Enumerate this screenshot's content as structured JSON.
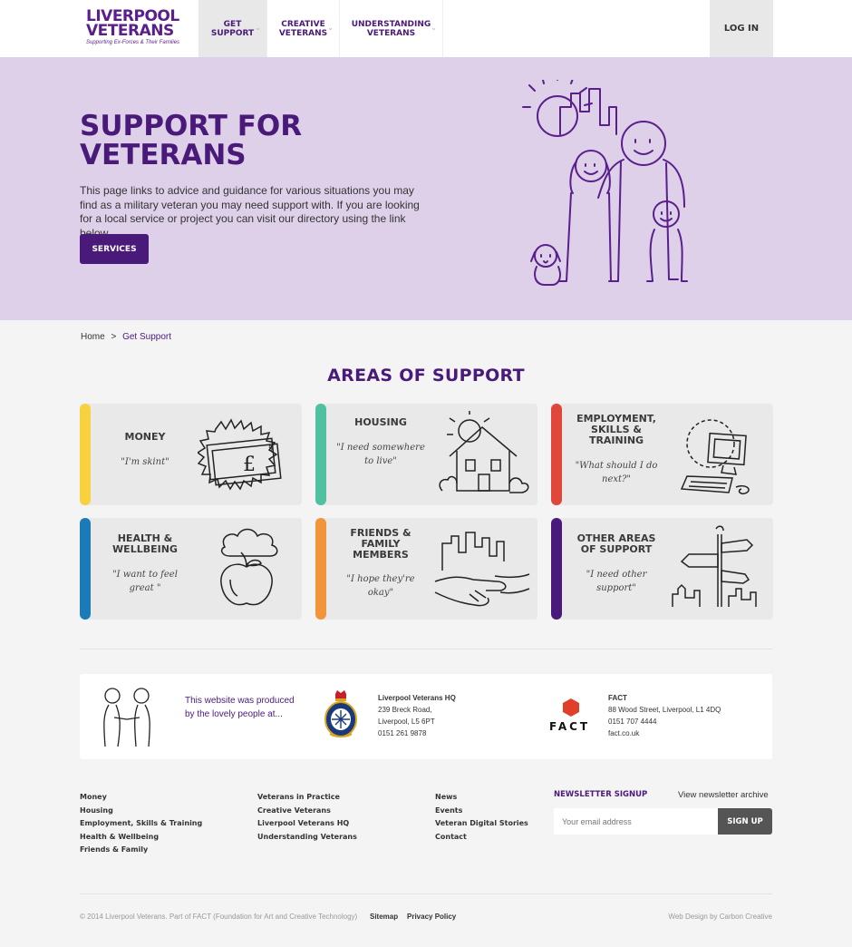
{
  "header": {
    "logo_line1": "LIVERPOOL",
    "logo_line2": "VETERANS",
    "logo_tagline": "Supporting Ex-Forces & Their Families",
    "nav": [
      {
        "label": "GET SUPPORT"
      },
      {
        "label": "CREATIVE VETERANS"
      },
      {
        "label": "UNDERSTANDING VETERANS"
      }
    ],
    "login_label": "LOG IN"
  },
  "hero": {
    "title": "SUPPORT FOR VETERANS",
    "text": "This page links to advice and guidance for various situations you may find as a military veteran you may need support with. If you are looking for a local service or project you can visit our directory using the link below.",
    "button": "SERVICES"
  },
  "breadcrumb": {
    "home": "Home",
    "separator": ">",
    "current": "Get Support"
  },
  "areas": {
    "title": "AREAS OF SUPPORT",
    "cards": [
      {
        "title": "MONEY",
        "quote": "\"I'm skint\"",
        "color": "#f7d23e",
        "icon": "banknote-icon"
      },
      {
        "title": "HOUSING",
        "quote": "\"I need somewhere to live\"",
        "color": "#4fc1a1",
        "icon": "house-icon"
      },
      {
        "title": "EMPLOYMENT, SKILLS & TRAINING",
        "quote": "\"What should I do next?\"",
        "color": "#e0463a",
        "icon": "computer-icon"
      },
      {
        "title": "HEALTH & WELLBEING",
        "quote": "\"I want to feel great \"",
        "color": "#1a7bb8",
        "icon": "apple-icon"
      },
      {
        "title": "FRIENDS & FAMILY MEMBERS",
        "quote": "\"I hope they're okay\"",
        "color": "#f2943a",
        "icon": "handshake-icon"
      },
      {
        "title": "OTHER AREAS OF SUPPORT",
        "quote": "\"I need other support\"",
        "color": "#4a1a7a",
        "icon": "signpost-icon"
      }
    ]
  },
  "partners": {
    "produced_text": "This website was produced by the lovely people at...",
    "hq": {
      "name": "Liverpool Veterans HQ",
      "line1": "239 Breck Road,",
      "line2": "Liverpool, L5 6PT",
      "phone": "0151 261 9878"
    },
    "fact": {
      "logo_text": "FACT",
      "name": "FACT",
      "line1": "88 Wood Street, Liverpool, L1 4DQ",
      "phone": "0151 707 4444",
      "web": "fact.co.uk"
    }
  },
  "footer": {
    "col1": [
      "Money",
      "Housing",
      "Employment, Skills & Training",
      "Health & Wellbeing",
      "Friends & Family"
    ],
    "col2": [
      "Veterans in Practice",
      "Creative Veterans",
      "Liverpool Veterans HQ",
      "Understanding Veterans"
    ],
    "col3": [
      "News",
      "Events",
      "Veteran Digital Stories",
      "Contact"
    ],
    "newsletter_title": "NEWSLETTER SIGNUP",
    "newsletter_archive": "View newsletter archive",
    "email_placeholder": "Your email address",
    "signup_label": "SIGN UP",
    "copyright": "© 2014 Liverpool Veterans. Part of FACT (Foundation for Art and Creative Technology)",
    "sitemap": "Sitemap",
    "privacy": "Privacy Policy",
    "credit": "Web Design by Carbon Creative"
  }
}
